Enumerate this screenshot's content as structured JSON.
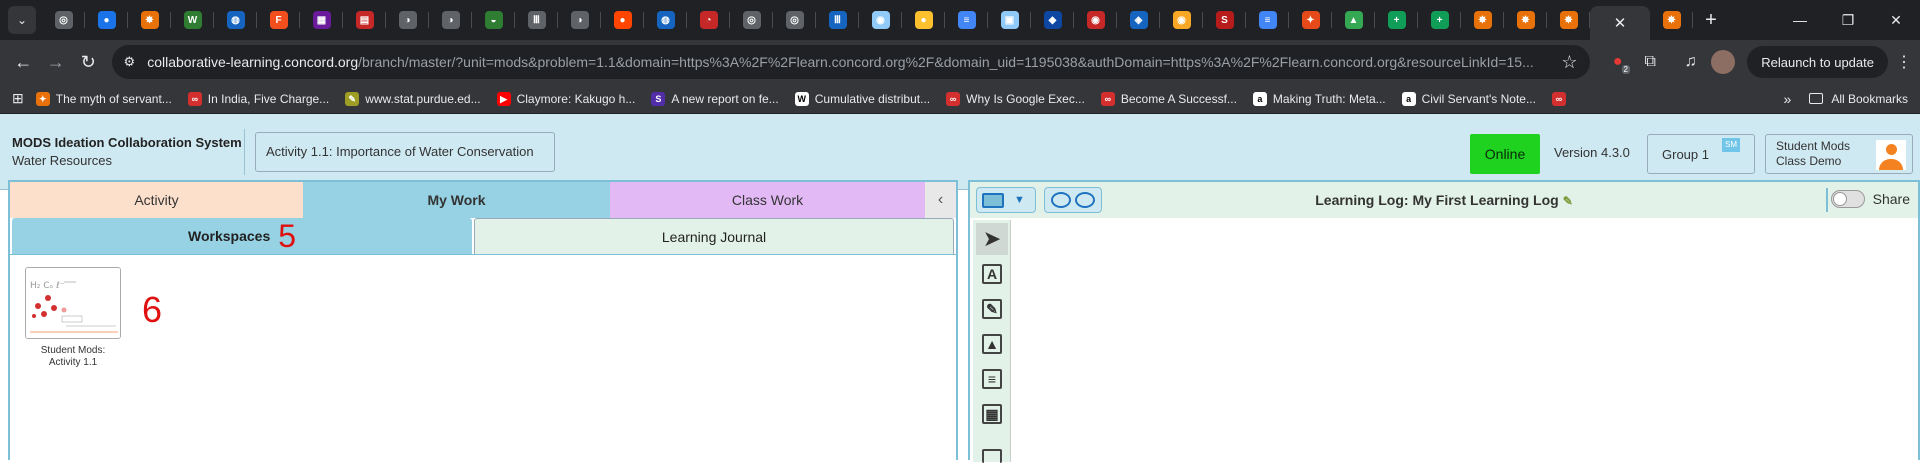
{
  "browser": {
    "favicons": [
      {
        "name": "chrome-icon",
        "color": "#5f6368",
        "glyph": "◎"
      },
      {
        "name": "site-icon-1",
        "color": "#1a73e8",
        "glyph": "●"
      },
      {
        "name": "site-icon-2",
        "color": "#e8710a",
        "glyph": "✸"
      },
      {
        "name": "site-icon-3",
        "color": "#2e7d32",
        "glyph": "W"
      },
      {
        "name": "site-icon-4",
        "color": "#1565c0",
        "glyph": "◍"
      },
      {
        "name": "figma-icon",
        "color": "#f24e1e",
        "glyph": "F"
      },
      {
        "name": "site-icon-5",
        "color": "#6a1b9a",
        "glyph": "▦"
      },
      {
        "name": "site-icon-6",
        "color": "#c62828",
        "glyph": "▤"
      },
      {
        "name": "site-icon-7",
        "color": "#5f6368",
        "glyph": "◑"
      },
      {
        "name": "site-icon-8",
        "color": "#5f6368",
        "glyph": "◑"
      },
      {
        "name": "site-icon-9",
        "color": "#2e7d32",
        "glyph": "◒"
      },
      {
        "name": "site-icon-10",
        "color": "#5f6368",
        "glyph": "Ⅲ"
      },
      {
        "name": "site-icon-11",
        "color": "#5f6368",
        "glyph": "◑"
      },
      {
        "name": "reddit-icon",
        "color": "#ff4500",
        "glyph": "●"
      },
      {
        "name": "site-icon-12",
        "color": "#1565c0",
        "glyph": "◍"
      },
      {
        "name": "site-icon-13",
        "color": "#c62828",
        "glyph": "◔"
      },
      {
        "name": "site-icon-14",
        "color": "#5f6368",
        "glyph": "◎"
      },
      {
        "name": "site-icon-15",
        "color": "#5f6368",
        "glyph": "◎"
      },
      {
        "name": "site-icon-16",
        "color": "#1565c0",
        "glyph": "Ⅲ"
      },
      {
        "name": "site-icon-17",
        "color": "#90caf9",
        "glyph": "◉"
      },
      {
        "name": "site-icon-18",
        "color": "#fbc02d",
        "glyph": "●"
      },
      {
        "name": "docs-icon",
        "color": "#4285f4",
        "glyph": "≡"
      },
      {
        "name": "site-icon-19",
        "color": "#90caf9",
        "glyph": "▣"
      },
      {
        "name": "site-icon-20",
        "color": "#0d47a1",
        "glyph": "◆"
      },
      {
        "name": "site-icon-21",
        "color": "#c62828",
        "glyph": "◉"
      },
      {
        "name": "site-icon-22",
        "color": "#1565c0",
        "glyph": "◈"
      },
      {
        "name": "site-icon-23",
        "color": "#f9a825",
        "glyph": "◉"
      },
      {
        "name": "site-icon-24",
        "color": "#b71c1c",
        "glyph": "S"
      },
      {
        "name": "docs-icon-2",
        "color": "#4285f4",
        "glyph": "≡"
      },
      {
        "name": "site-icon-25",
        "color": "#e64a19",
        "glyph": "✦"
      },
      {
        "name": "drive-icon",
        "color": "#34a853",
        "glyph": "▲"
      },
      {
        "name": "sheets-icon",
        "color": "#0f9d58",
        "glyph": "+"
      },
      {
        "name": "sheets-icon-2",
        "color": "#0f9d58",
        "glyph": "+"
      },
      {
        "name": "site-icon-26",
        "color": "#e8710a",
        "glyph": "✸"
      },
      {
        "name": "site-icon-27",
        "color": "#e8710a",
        "glyph": "✸"
      },
      {
        "name": "site-icon-28",
        "color": "#e8710a",
        "glyph": "✸"
      }
    ],
    "active_tab_close": "✕",
    "after_tab_favicon": {
      "name": "site-icon-29",
      "color": "#e8710a",
      "glyph": "✸"
    },
    "newtab": "+",
    "url_host": "collaborative-learning.concord.org",
    "url_path": "/branch/master/?unit=mods&problem=1.1&domain=https%3A%2F%2Flearn.concord.org%2F&domain_uid=1195038&authDomain=https%3A%2F%2Flearn.concord.org&resourceLinkId=15...",
    "ext_badge": "2",
    "relaunch": "Relaunch to update",
    "bookmarks": [
      {
        "label": "The myth of servant...",
        "color": "#e8710a",
        "glyph": "✦"
      },
      {
        "label": "In India, Five Charge...",
        "color": "#d32f2f",
        "glyph": "∞"
      },
      {
        "label": "www.stat.purdue.ed...",
        "color": "#9e9d24",
        "glyph": "✎"
      },
      {
        "label": "Claymore: Kakugo h...",
        "color": "#ff0000",
        "glyph": "▶"
      },
      {
        "label": "A new report on fe...",
        "color": "#512da8",
        "glyph": "S"
      },
      {
        "label": "Cumulative distribut...",
        "color": "#ffffff",
        "glyph": "W"
      },
      {
        "label": "Why Is Google Exec...",
        "color": "#d32f2f",
        "glyph": "∞"
      },
      {
        "label": "Become A Successf...",
        "color": "#d32f2f",
        "glyph": "∞"
      },
      {
        "label": "Making Truth: Meta...",
        "color": "#ffffff",
        "glyph": "a"
      },
      {
        "label": "Civil Servant's Note...",
        "color": "#ffffff",
        "glyph": "a"
      },
      {
        "label": "",
        "color": "#d32f2f",
        "glyph": "∞"
      }
    ],
    "all_bookmarks": "All Bookmarks"
  },
  "app": {
    "title": "MODS Ideation Collaboration System",
    "subtitle": "Water Resources",
    "activity": "Activity 1.1: Importance of Water Conservation",
    "status": "Online",
    "version": "Version 4.3.0",
    "group": "Group 1",
    "group_badge": "SM",
    "user_line1": "Student Mods",
    "user_line2": "Class Demo"
  },
  "left_panel": {
    "tabs": [
      "Activity",
      "My Work",
      "Class Work"
    ],
    "collapse": "‹",
    "subtabs": [
      "Workspaces",
      "Learning Journal"
    ],
    "anno_5": "5",
    "anno_6": "6",
    "thumb_caption_1": "Student Mods:",
    "thumb_caption_2": "Activity 1.1"
  },
  "right_panel": {
    "title": "Learning Log: My First Learning Log",
    "share": "Share",
    "tools": [
      "select-tool",
      "text-tool",
      "drawing-tool",
      "image-tool",
      "document-tool",
      "table-tool"
    ]
  }
}
